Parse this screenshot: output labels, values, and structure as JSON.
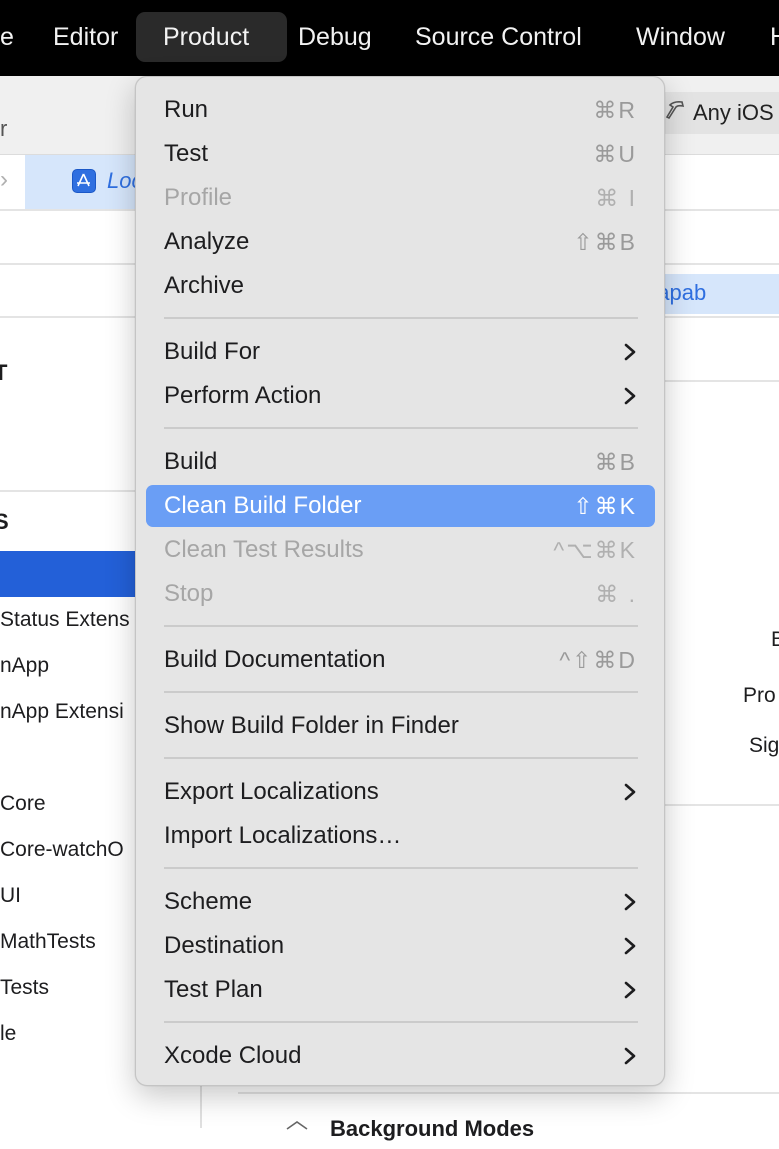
{
  "menubar": {
    "items": [
      {
        "label": "e"
      },
      {
        "label": "Editor"
      },
      {
        "label": "Product",
        "active": true
      },
      {
        "label": "Debug"
      },
      {
        "label": "Source Control"
      },
      {
        "label": "Window"
      },
      {
        "label": "H"
      }
    ]
  },
  "background": {
    "toolbar_text": "r",
    "scheme_destination": "Any iOS",
    "editor_tab": "Loc",
    "capabilities_tab": "ng & Capab",
    "section_project": "T",
    "section_targets": "S",
    "targets": [
      {
        "label": "",
        "selected": true
      },
      {
        "label": "Status Extens"
      },
      {
        "label": "nApp"
      },
      {
        "label": "nApp Extensi"
      },
      {
        "label": "Core"
      },
      {
        "label": "Core-watchO"
      },
      {
        "label": "UI"
      },
      {
        "label": "MathTests"
      },
      {
        "label": "Tests"
      },
      {
        "label": "le"
      }
    ],
    "right_labels": [
      "B",
      "Pro",
      "Sig"
    ],
    "background_modes": "Background Modes"
  },
  "product_menu": {
    "items": [
      {
        "label": "Run",
        "shortcut": "⌘R"
      },
      {
        "label": "Test",
        "shortcut": "⌘U"
      },
      {
        "label": "Profile",
        "shortcut": "⌘ I",
        "disabled": true
      },
      {
        "label": "Analyze",
        "shortcut": "⇧⌘B"
      },
      {
        "label": "Archive",
        "shortcut": ""
      },
      {
        "label": "Build For",
        "submenu": true
      },
      {
        "label": "Perform Action",
        "submenu": true
      },
      {
        "label": "Build",
        "shortcut": "⌘B"
      },
      {
        "label": "Clean Build Folder",
        "shortcut": "⇧⌘K",
        "highlighted": true
      },
      {
        "label": "Clean Test Results",
        "shortcut": "^⌥⌘K",
        "disabled": true
      },
      {
        "label": "Stop",
        "shortcut": "⌘ .",
        "disabled": true
      },
      {
        "label": "Build Documentation",
        "shortcut": "^⇧⌘D"
      },
      {
        "label": "Show Build Folder in Finder",
        "shortcut": ""
      },
      {
        "label": "Export Localizations",
        "submenu": true
      },
      {
        "label": "Import Localizations…",
        "shortcut": ""
      },
      {
        "label": "Scheme",
        "submenu": true
      },
      {
        "label": "Destination",
        "submenu": true
      },
      {
        "label": "Test Plan",
        "submenu": true
      },
      {
        "label": "Xcode Cloud",
        "submenu": true
      }
    ]
  },
  "colors": {
    "highlight": "#6a9ef5",
    "accent_blue": "#2f6fe0",
    "selection_blue": "#2360d8"
  }
}
